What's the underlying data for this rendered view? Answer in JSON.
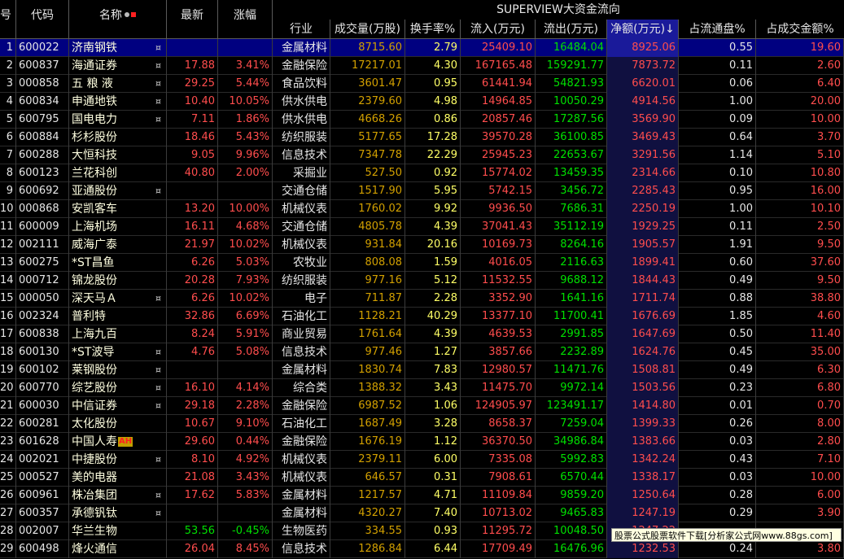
{
  "headers": {
    "index": "号",
    "code": "代码",
    "name": "名称",
    "last": "最新",
    "change": "涨幅",
    "group_title": "SUPERVIEW大资金流向",
    "industry": "行业",
    "volume": "成交量(万股)",
    "turnover": "换手率%",
    "inflow": "流入(万元)",
    "outflow": "流出(万元)",
    "net": "净额(万元)↓",
    "float_ratio": "占流通盘%",
    "amount_ratio": "占成交金额%"
  },
  "rows": [
    {
      "idx": "1",
      "code": "600022",
      "name": "济南钢铁",
      "flag": "¤",
      "last": "",
      "change": "",
      "industry": "金属材料",
      "volume": "8715.60",
      "turnover": "2.79",
      "inflow": "25409.10",
      "outflow": "16484.04",
      "net": "8925.06",
      "float_ratio": "0.55",
      "amount_ratio": "19.60",
      "selected": true
    },
    {
      "idx": "2",
      "code": "600837",
      "name": "海通证券",
      "flag": "¤",
      "last": "17.88",
      "change": "3.41%",
      "industry": "金融保险",
      "volume": "17217.01",
      "turnover": "4.30",
      "inflow": "167165.48",
      "outflow": "159291.77",
      "net": "7873.72",
      "float_ratio": "0.11",
      "amount_ratio": "2.60"
    },
    {
      "idx": "3",
      "code": "000858",
      "name": "五 粮 液",
      "flag": "¤",
      "last": "29.25",
      "change": "5.44%",
      "industry": "食品饮料",
      "volume": "3601.47",
      "turnover": "0.95",
      "inflow": "61441.94",
      "outflow": "54821.93",
      "net": "6620.01",
      "float_ratio": "0.06",
      "amount_ratio": "6.40"
    },
    {
      "idx": "4",
      "code": "600834",
      "name": "申通地铁",
      "flag": "¤",
      "last": "10.40",
      "change": "10.05%",
      "industry": "供水供电",
      "volume": "2379.60",
      "turnover": "4.98",
      "inflow": "14964.85",
      "outflow": "10050.29",
      "net": "4914.56",
      "float_ratio": "1.00",
      "amount_ratio": "20.00"
    },
    {
      "idx": "5",
      "code": "600795",
      "name": "国电电力",
      "flag": "¤",
      "last": "7.11",
      "change": "1.86%",
      "industry": "供水供电",
      "volume": "4668.26",
      "turnover": "0.86",
      "inflow": "20857.46",
      "outflow": "17287.56",
      "net": "3569.90",
      "float_ratio": "0.09",
      "amount_ratio": "10.00"
    },
    {
      "idx": "6",
      "code": "600884",
      "name": "杉杉股份",
      "flag": "",
      "last": "18.46",
      "change": "5.43%",
      "industry": "纺织服装",
      "volume": "5177.65",
      "turnover": "17.28",
      "inflow": "39570.28",
      "outflow": "36100.85",
      "net": "3469.43",
      "float_ratio": "0.64",
      "amount_ratio": "3.70"
    },
    {
      "idx": "7",
      "code": "600288",
      "name": "大恒科技",
      "flag": "",
      "last": "9.05",
      "change": "9.96%",
      "industry": "信息技术",
      "volume": "7347.78",
      "turnover": "22.29",
      "inflow": "25945.23",
      "outflow": "22653.67",
      "net": "3291.56",
      "float_ratio": "1.14",
      "amount_ratio": "5.10"
    },
    {
      "idx": "8",
      "code": "600123",
      "name": "兰花科创",
      "flag": "",
      "last": "40.80",
      "change": "2.00%",
      "industry": "采掘业",
      "volume": "527.50",
      "turnover": "0.92",
      "inflow": "15774.02",
      "outflow": "13459.35",
      "net": "2314.66",
      "float_ratio": "0.10",
      "amount_ratio": "10.80"
    },
    {
      "idx": "9",
      "code": "600692",
      "name": "亚通股份",
      "flag": "¤",
      "last": "",
      "change": "",
      "industry": "交通仓储",
      "volume": "1517.90",
      "turnover": "5.95",
      "inflow": "5742.15",
      "outflow": "3456.72",
      "net": "2285.43",
      "float_ratio": "0.95",
      "amount_ratio": "16.00"
    },
    {
      "idx": "10",
      "code": "000868",
      "name": "安凯客车",
      "flag": "",
      "last": "13.20",
      "change": "10.00%",
      "industry": "机械仪表",
      "volume": "1760.02",
      "turnover": "9.92",
      "inflow": "9936.50",
      "outflow": "7686.31",
      "net": "2250.19",
      "float_ratio": "1.00",
      "amount_ratio": "10.10"
    },
    {
      "idx": "11",
      "code": "600009",
      "name": "上海机场",
      "flag": "",
      "last": "16.11",
      "change": "4.68%",
      "industry": "交通仓储",
      "volume": "4805.78",
      "turnover": "4.39",
      "inflow": "37041.43",
      "outflow": "35112.19",
      "net": "1929.25",
      "float_ratio": "0.11",
      "amount_ratio": "2.50"
    },
    {
      "idx": "12",
      "code": "002111",
      "name": "威海广泰",
      "flag": "",
      "last": "21.97",
      "change": "10.02%",
      "industry": "机械仪表",
      "volume": "931.84",
      "turnover": "20.16",
      "inflow": "10169.73",
      "outflow": "8264.16",
      "net": "1905.57",
      "float_ratio": "1.91",
      "amount_ratio": "9.50"
    },
    {
      "idx": "13",
      "code": "600275",
      "name": "*ST昌鱼",
      "flag": "",
      "last": "6.26",
      "change": "5.03%",
      "industry": "农牧业",
      "volume": "808.08",
      "turnover": "1.59",
      "inflow": "4016.05",
      "outflow": "2116.63",
      "net": "1899.41",
      "float_ratio": "0.60",
      "amount_ratio": "37.60"
    },
    {
      "idx": "14",
      "code": "000712",
      "name": "锦龙股份",
      "flag": "",
      "last": "20.28",
      "change": "7.93%",
      "industry": "纺织服装",
      "volume": "977.16",
      "turnover": "5.12",
      "inflow": "11532.55",
      "outflow": "9688.12",
      "net": "1844.43",
      "float_ratio": "0.49",
      "amount_ratio": "9.50"
    },
    {
      "idx": "15",
      "code": "000050",
      "name": "深天马Ａ",
      "flag": "¤",
      "last": "6.26",
      "change": "10.02%",
      "industry": "电子",
      "volume": "711.87",
      "turnover": "2.28",
      "inflow": "3352.90",
      "outflow": "1641.16",
      "net": "1711.74",
      "float_ratio": "0.88",
      "amount_ratio": "38.80"
    },
    {
      "idx": "16",
      "code": "002324",
      "name": "普利特",
      "flag": "",
      "last": "32.86",
      "change": "6.69%",
      "industry": "石油化工",
      "volume": "1128.21",
      "turnover": "40.29",
      "inflow": "13377.10",
      "outflow": "11700.41",
      "net": "1676.69",
      "float_ratio": "1.85",
      "amount_ratio": "4.60"
    },
    {
      "idx": "17",
      "code": "600838",
      "name": "上海九百",
      "flag": "",
      "last": "8.24",
      "change": "5.91%",
      "industry": "商业贸易",
      "volume": "1761.64",
      "turnover": "4.39",
      "inflow": "4639.53",
      "outflow": "2991.85",
      "net": "1647.69",
      "float_ratio": "0.50",
      "amount_ratio": "11.40"
    },
    {
      "idx": "18",
      "code": "600130",
      "name": "*ST波导",
      "flag": "¤",
      "last": "4.76",
      "change": "5.08%",
      "industry": "信息技术",
      "volume": "977.46",
      "turnover": "1.27",
      "inflow": "3857.66",
      "outflow": "2232.89",
      "net": "1624.76",
      "float_ratio": "0.45",
      "amount_ratio": "35.00"
    },
    {
      "idx": "19",
      "code": "600102",
      "name": "莱钢股份",
      "flag": "¤",
      "last": "",
      "change": "",
      "industry": "金属材料",
      "volume": "1830.74",
      "turnover": "7.83",
      "inflow": "12980.57",
      "outflow": "11471.76",
      "net": "1508.81",
      "float_ratio": "0.49",
      "amount_ratio": "6.30"
    },
    {
      "idx": "20",
      "code": "600770",
      "name": "综艺股份",
      "flag": "¤",
      "last": "16.10",
      "change": "4.14%",
      "industry": "综合类",
      "volume": "1388.32",
      "turnover": "3.43",
      "inflow": "11475.70",
      "outflow": "9972.14",
      "net": "1503.56",
      "float_ratio": "0.23",
      "amount_ratio": "6.80"
    },
    {
      "idx": "21",
      "code": "600030",
      "name": "中信证券",
      "flag": "¤",
      "last": "29.18",
      "change": "2.28%",
      "industry": "金融保险",
      "volume": "6987.52",
      "turnover": "1.06",
      "inflow": "124905.97",
      "outflow": "123491.17",
      "net": "1414.80",
      "float_ratio": "0.01",
      "amount_ratio": "0.70"
    },
    {
      "idx": "22",
      "code": "600281",
      "name": "太化股份",
      "flag": "",
      "last": "10.67",
      "change": "9.10%",
      "industry": "石油化工",
      "volume": "1687.49",
      "turnover": "3.28",
      "inflow": "8658.37",
      "outflow": "7259.04",
      "net": "1399.33",
      "float_ratio": "0.26",
      "amount_ratio": "8.00"
    },
    {
      "idx": "23",
      "code": "601628",
      "name": "中国人寿",
      "flag": "",
      "ah": "AH",
      "last": "29.60",
      "change": "0.44%",
      "industry": "金融保险",
      "volume": "1676.19",
      "turnover": "1.12",
      "inflow": "36370.50",
      "outflow": "34986.84",
      "net": "1383.66",
      "float_ratio": "0.03",
      "amount_ratio": "2.80"
    },
    {
      "idx": "24",
      "code": "002021",
      "name": "中捷股份",
      "flag": "¤",
      "last": "8.10",
      "change": "4.92%",
      "industry": "机械仪表",
      "volume": "2379.11",
      "turnover": "6.00",
      "inflow": "7335.08",
      "outflow": "5992.83",
      "net": "1342.24",
      "float_ratio": "0.43",
      "amount_ratio": "7.10"
    },
    {
      "idx": "25",
      "code": "000527",
      "name": "美的电器",
      "flag": "",
      "last": "21.08",
      "change": "3.43%",
      "industry": "机械仪表",
      "volume": "646.57",
      "turnover": "0.31",
      "inflow": "7908.61",
      "outflow": "6570.44",
      "net": "1338.17",
      "float_ratio": "0.03",
      "amount_ratio": "10.00"
    },
    {
      "idx": "26",
      "code": "600961",
      "name": "株冶集团",
      "flag": "¤",
      "last": "17.62",
      "change": "5.83%",
      "industry": "金属材料",
      "volume": "1217.57",
      "turnover": "4.71",
      "inflow": "11109.84",
      "outflow": "9859.20",
      "net": "1250.64",
      "float_ratio": "0.28",
      "amount_ratio": "6.00"
    },
    {
      "idx": "27",
      "code": "600357",
      "name": "承德钒钛",
      "flag": "¤",
      "last": "",
      "change": "",
      "industry": "金属材料",
      "volume": "4320.27",
      "turnover": "7.40",
      "inflow": "10713.02",
      "outflow": "9465.83",
      "net": "1247.19",
      "float_ratio": "0.29",
      "amount_ratio": "3.90"
    },
    {
      "idx": "28",
      "code": "002007",
      "name": "华兰生物",
      "flag": "",
      "last": "53.56",
      "change": "-0.45%",
      "industry": "生物医药",
      "volume": "334.55",
      "turnover": "0.93",
      "inflow": "11295.72",
      "outflow": "10048.50",
      "net": "1247.22",
      "float_ratio": "",
      "amount_ratio": ""
    },
    {
      "idx": "29",
      "code": "600498",
      "name": "烽火通信",
      "flag": "",
      "last": "26.04",
      "change": "8.45%",
      "industry": "信息技术",
      "volume": "1286.84",
      "turnover": "6.44",
      "inflow": "17709.49",
      "outflow": "16476.96",
      "net": "1232.53",
      "float_ratio": "0.24",
      "amount_ratio": "3.80"
    }
  ],
  "tooltip": "股票公式股票软件下载[分析家公式网www.88gs.com]",
  "colors": {
    "up": "#ff4d4d",
    "down": "#00e000",
    "selected": "#000080"
  }
}
